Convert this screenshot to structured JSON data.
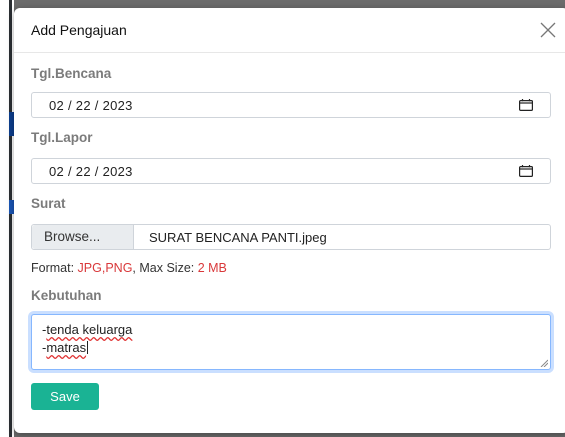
{
  "modal": {
    "title": "Add Pengajuan"
  },
  "form": {
    "tgl_bencana": {
      "label": "Tgl.Bencana",
      "value": "02 / 22 / 2023"
    },
    "tgl_lapor": {
      "label": "Tgl.Lapor",
      "value": "02 / 22 / 2023"
    },
    "surat": {
      "label": "Surat",
      "browse_label": "Browse...",
      "file_name": "SURAT BENCANA PANTI.jpeg"
    },
    "format": {
      "prefix": "Format: ",
      "types": "JPG,PNG",
      "middle": ", Max Size: ",
      "size": "2 MB"
    },
    "kebutuhan": {
      "label": "Kebutuhan",
      "lines": [
        {
          "dash": "-",
          "word": "tenda keluarga"
        },
        {
          "dash": "-",
          "word": "matras"
        }
      ]
    },
    "save_label": "Save"
  },
  "colors": {
    "accent": "#1ab394",
    "warning_text": "#d9383a",
    "focus_border": "#86b7fe"
  },
  "icons": [
    "close-icon",
    "calendar-icon",
    "calendar-icon",
    "resize-grip-icon"
  ]
}
